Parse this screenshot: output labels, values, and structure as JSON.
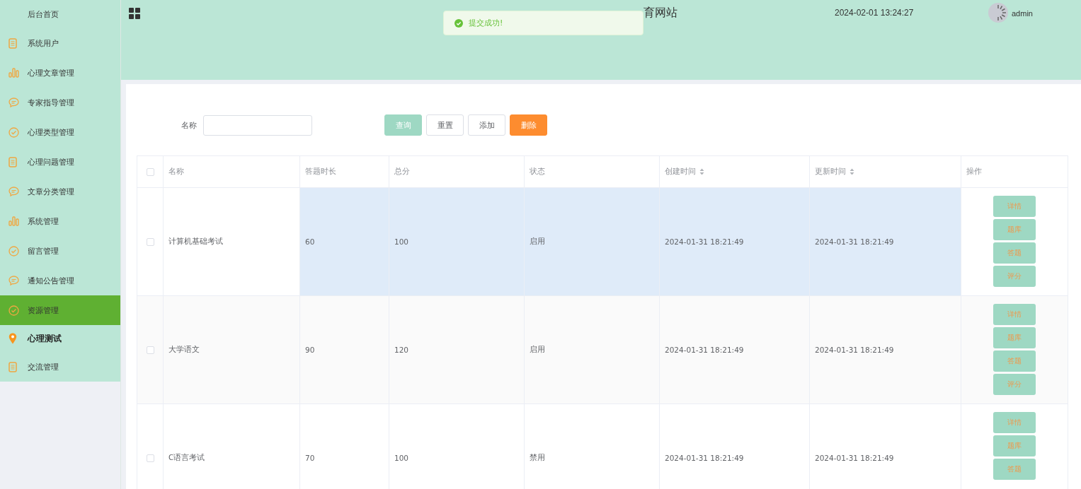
{
  "sidebar": {
    "items": [
      {
        "label": "后台首页",
        "kind": "none",
        "highlighted": false,
        "selected": false
      },
      {
        "label": "系统用户",
        "kind": "doc",
        "highlighted": false,
        "selected": false
      },
      {
        "label": "心理文章管理",
        "kind": "bars",
        "highlighted": false,
        "selected": false
      },
      {
        "label": "专家指导管理",
        "kind": "chat",
        "highlighted": false,
        "selected": false
      },
      {
        "label": "心理类型管理",
        "kind": "check",
        "highlighted": false,
        "selected": false
      },
      {
        "label": "心理问题管理",
        "kind": "doc",
        "highlighted": false,
        "selected": false
      },
      {
        "label": "文章分类管理",
        "kind": "chat",
        "highlighted": false,
        "selected": false
      },
      {
        "label": "系统管理",
        "kind": "bars",
        "highlighted": false,
        "selected": false
      },
      {
        "label": "留言管理",
        "kind": "check",
        "highlighted": false,
        "selected": false
      },
      {
        "label": "通知公告管理",
        "kind": "chat",
        "highlighted": false,
        "selected": false
      },
      {
        "label": "资源管理",
        "kind": "check",
        "highlighted": true,
        "selected": false
      },
      {
        "label": "心理测试",
        "kind": "pin",
        "highlighted": false,
        "selected": true
      },
      {
        "label": "交流管理",
        "kind": "doc",
        "highlighted": false,
        "selected": false
      }
    ]
  },
  "header": {
    "title": "育网站",
    "datetime": "2024-02-01 13:24:27",
    "user": "admin"
  },
  "toast": {
    "message": "提交成功!"
  },
  "search": {
    "label": "名称",
    "buttons": [
      {
        "label": "查询",
        "kind": "primary"
      },
      {
        "label": "重置",
        "kind": "plain"
      },
      {
        "label": "添加",
        "kind": "plain"
      },
      {
        "label": "删除",
        "kind": "danger"
      }
    ]
  },
  "table": {
    "all_checked": false,
    "columns": [
      {
        "label": "名称",
        "sortable": false
      },
      {
        "label": "答题时长",
        "sortable": false
      },
      {
        "label": "总分",
        "sortable": false
      },
      {
        "label": "状态",
        "sortable": false
      },
      {
        "label": "创建时间",
        "sortable": true
      },
      {
        "label": "更新时间",
        "sortable": true
      },
      {
        "label": "操作",
        "sortable": false
      }
    ],
    "rows": [
      {
        "cells": [
          "计算机基础考试",
          "60",
          "100",
          "启用",
          "2024-01-31 18:21:49",
          "2024-01-31 18:21:49"
        ],
        "checked": false,
        "highlighted": true,
        "actions": [
          "详情",
          "题库",
          "答题",
          "评分"
        ]
      },
      {
        "cells": [
          "大学语文",
          "90",
          "120",
          "启用",
          "2024-01-31 18:21:49",
          "2024-01-31 18:21:49"
        ],
        "checked": false,
        "highlighted": false,
        "actions": [
          "详情",
          "题库",
          "答题",
          "评分"
        ]
      },
      {
        "cells": [
          "C语言考试",
          "70",
          "100",
          "禁用",
          "2024-01-31 18:21:49",
          "2024-01-31 18:21:49"
        ],
        "checked": false,
        "highlighted": false,
        "actions": [
          "详情",
          "题库",
          "答题"
        ]
      }
    ]
  }
}
